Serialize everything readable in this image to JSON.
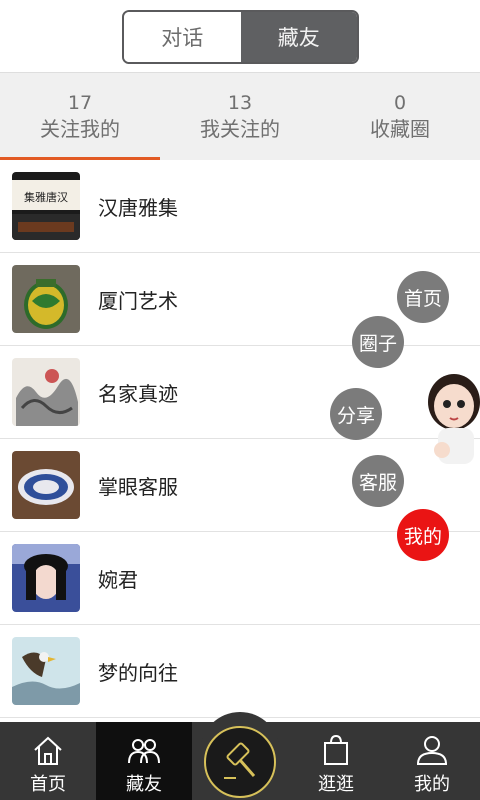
{
  "segments": {
    "left": "对话",
    "right": "藏友"
  },
  "stats": [
    {
      "count": "17",
      "label": "关注我的"
    },
    {
      "count": "13",
      "label": "我关注的"
    },
    {
      "count": "0",
      "label": "收藏圈"
    }
  ],
  "friends": [
    {
      "name": "汉唐雅集",
      "avatar_text": "集雅唐汉"
    },
    {
      "name": "厦门艺术"
    },
    {
      "name": "名家真迹"
    },
    {
      "name": "掌眼客服"
    },
    {
      "name": "婉君"
    },
    {
      "name": "梦的向往"
    }
  ],
  "float_menu": {
    "home": "首页",
    "circle": "圈子",
    "share": "分享",
    "service": "客服",
    "mine": "我的"
  },
  "bottom_nav": {
    "home": "首页",
    "friends": "藏友",
    "browse": "逛逛",
    "mine": "我的"
  },
  "colors": {
    "accent": "#e25a24",
    "mine_bubble": "#ea1414",
    "hammer_ring": "#d7c15a"
  }
}
